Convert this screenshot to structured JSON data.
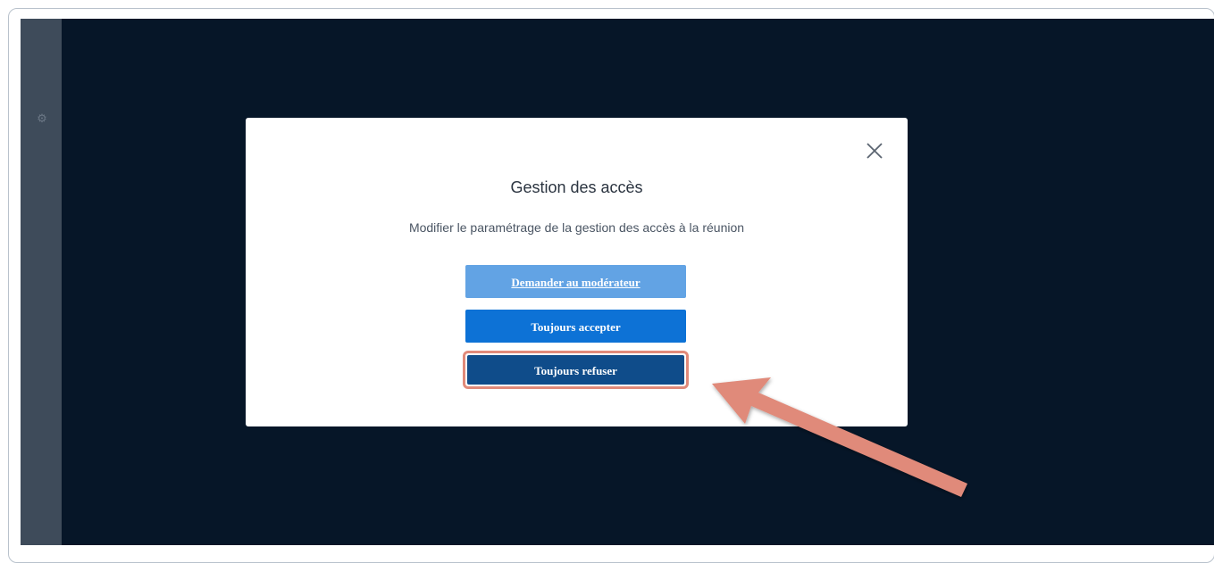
{
  "modal": {
    "title": "Gestion des accès",
    "subtitle": "Modifier le paramétrage de la gestion des accès à la réunion",
    "buttons": {
      "ask_moderator": "Demander au modérateur",
      "always_accept": "Toujours accepter",
      "always_refuse": "Toujours refuser"
    }
  },
  "icons": {
    "close": "close-icon",
    "settings": "gear-icon",
    "annotation": "arrow-annotation"
  },
  "colors": {
    "background": "#061628",
    "sidebar": "#3e4b5a",
    "ask_button": "#62a3e4",
    "accept_button": "#0d72d6",
    "refuse_button": "#0f4c8a",
    "highlight": "#e08a7a"
  }
}
